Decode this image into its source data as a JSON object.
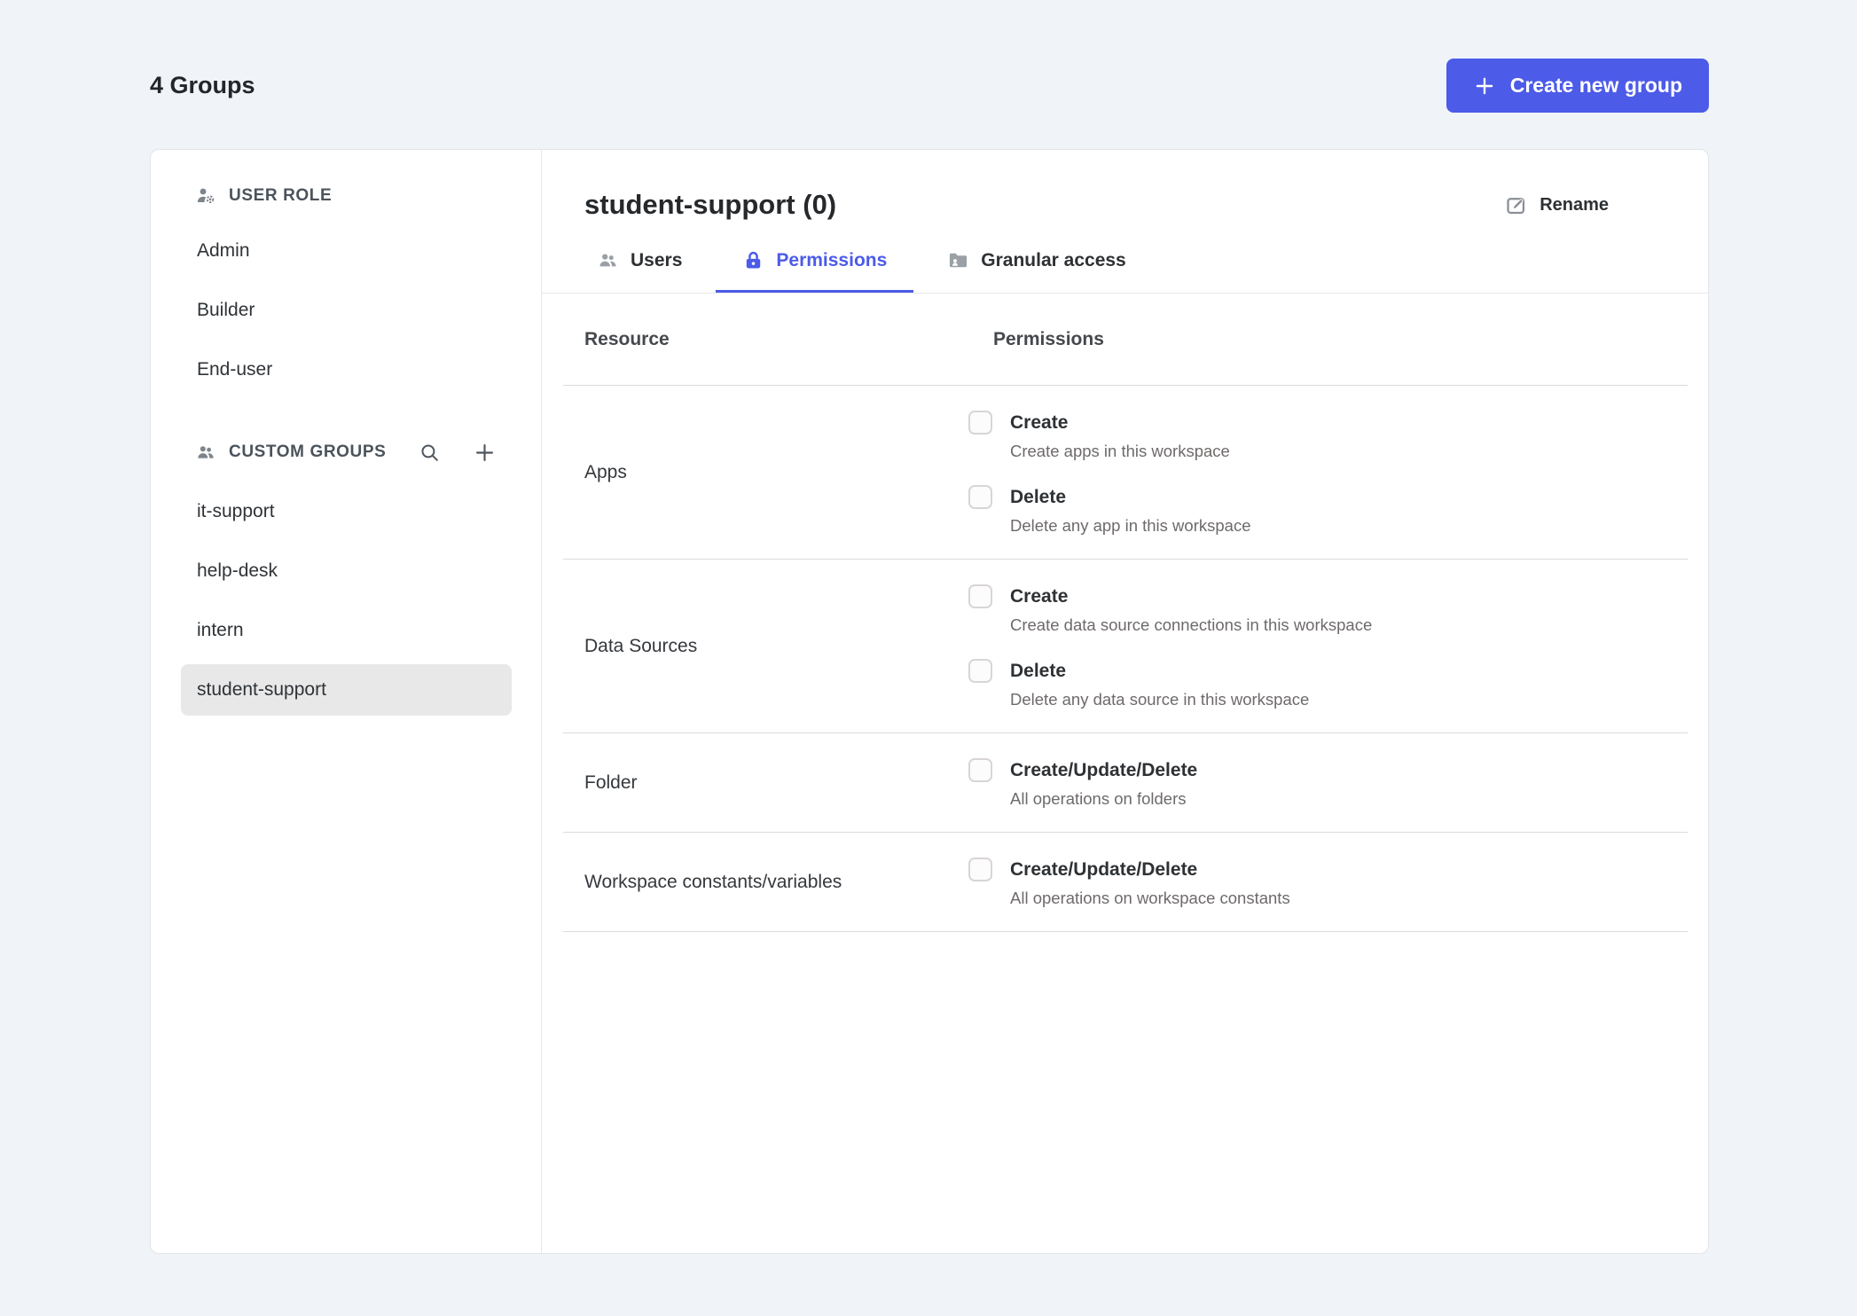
{
  "header": {
    "title": "4 Groups",
    "create_button_label": "Create new group"
  },
  "sidebar": {
    "user_role": {
      "label": "USER ROLE",
      "icon": "user-role-icon",
      "items": [
        "Admin",
        "Builder",
        "End-user"
      ]
    },
    "custom_groups": {
      "label": "CUSTOM GROUPS",
      "icon": "groups-icon",
      "actions": [
        "search-icon",
        "add-group-icon"
      ],
      "items": [
        "it-support",
        "help-desk",
        "intern",
        "student-support"
      ],
      "selected": "student-support"
    }
  },
  "main": {
    "title": "student-support (0)",
    "rename_label": "Rename",
    "rename_icon": "edit-icon",
    "tabs": [
      {
        "label": "Users",
        "icon": "users-icon",
        "active": false
      },
      {
        "label": "Permissions",
        "icon": "lock-icon",
        "active": true
      },
      {
        "label": "Granular access",
        "icon": "folder-user-icon",
        "active": false
      }
    ],
    "table": {
      "columns": [
        "Resource",
        "Permissions"
      ],
      "rows": [
        {
          "resource": "Apps",
          "permissions": [
            {
              "label": "Create",
              "description": "Create apps in this workspace",
              "checked": false
            },
            {
              "label": "Delete",
              "description": "Delete any app in this workspace",
              "checked": false
            }
          ]
        },
        {
          "resource": "Data Sources",
          "permissions": [
            {
              "label": "Create",
              "description": "Create data source connections in this workspace",
              "checked": false
            },
            {
              "label": "Delete",
              "description": "Delete any data source in this workspace",
              "checked": false
            }
          ]
        },
        {
          "resource": "Folder",
          "permissions": [
            {
              "label": "Create/Update/Delete",
              "description": "All operations on folders",
              "checked": false
            }
          ]
        },
        {
          "resource": "Workspace constants/variables",
          "permissions": [
            {
              "label": "Create/Update/Delete",
              "description": "All operations on workspace constants",
              "checked": false
            }
          ]
        }
      ]
    }
  },
  "colors": {
    "accent": "#4c5be8",
    "page_background": "#f0f4f8",
    "card_background": "#ffffff",
    "selected_item_background": "#e8e8e8"
  }
}
